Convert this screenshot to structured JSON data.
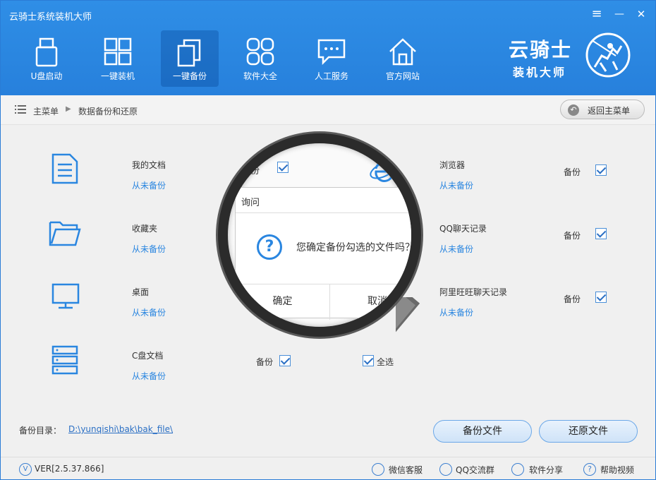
{
  "window": {
    "title": "云骑士系统装机大师",
    "menu_icon": "≡",
    "minimize_icon": "—",
    "close_icon": "✕"
  },
  "nav": [
    {
      "label": "U盘启动",
      "icon": "usb-drive-icon"
    },
    {
      "label": "一键装机",
      "icon": "windows-logo-icon"
    },
    {
      "label": "一键备份",
      "icon": "copy-icon",
      "active": true
    },
    {
      "label": "软件大全",
      "icon": "apps-grid-icon"
    },
    {
      "label": "人工服务",
      "icon": "chat-bubble-icon"
    },
    {
      "label": "官方网站",
      "icon": "home-icon"
    }
  ],
  "logo": {
    "line1": "云骑士",
    "line2": "装机大师"
  },
  "breadcrumb": {
    "root": "主菜单",
    "current": "数据备份和还原",
    "back_button": "返回主菜单"
  },
  "items_left": [
    {
      "name": "我的文档",
      "status": "从未备份",
      "icon": "document-icon"
    },
    {
      "name": "收藏夹",
      "status": "从未备份",
      "icon": "folder-icon"
    },
    {
      "name": "桌面",
      "status": "从未备份",
      "icon": "monitor-icon"
    },
    {
      "name": "C盘文档",
      "status": "从未备份",
      "icon": "server-rack-icon"
    }
  ],
  "items_right": [
    {
      "name": "浏览器",
      "status": "从未备份",
      "backup_label": "备份",
      "checked": true
    },
    {
      "name": "QQ聊天记录",
      "status": "从未备份",
      "backup_label": "备份",
      "checked": true
    },
    {
      "name": "阿里旺旺聊天记录",
      "status": "从未备份",
      "backup_label": "备份",
      "checked": true
    }
  ],
  "c_drive_backup_label": "备份",
  "select_all_label": "全选",
  "lens_fragment_label": "份",
  "backup_dir": {
    "label": "备份目录：",
    "path": "D:\\yunqishi\\bak\\bak_file\\"
  },
  "buttons": {
    "backup": "备份文件",
    "restore": "还原文件"
  },
  "dialog": {
    "title": "询问",
    "message": "您确定备份勾选的文件吗？",
    "ok": "确定",
    "cancel": "取消"
  },
  "footer": {
    "version": "VER[2.5.37.866]",
    "links": [
      "微信客服",
      "QQ交流群",
      "软件分享",
      "帮助视频"
    ]
  },
  "colors": {
    "header": "#2a86e0",
    "accent": "#2a86e0",
    "link": "#2a6fc4"
  }
}
